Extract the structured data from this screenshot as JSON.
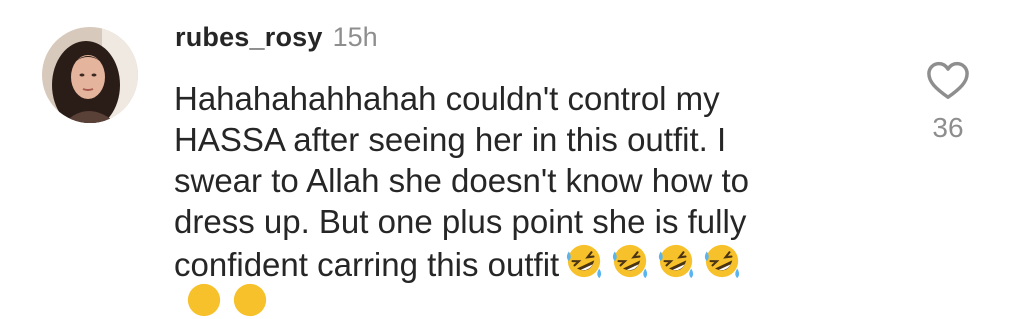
{
  "comment": {
    "username": "rubes_rosy",
    "timestamp": "15h",
    "text_lines": [
      "Hahahahahhahah couldn't control my",
      "HASSA after seeing her in this outfit. I",
      "swear to Allah she doesn't know how to",
      "dress up. But one plus point she is fully",
      "confident carring this outfit"
    ],
    "emoji": [
      "rolling-on-floor-laughing",
      "rolling-on-floor-laughing",
      "rolling-on-floor-laughing",
      "rolling-on-floor-laughing"
    ],
    "emoji_second_row_partial": [
      "rolling-on-floor-laughing",
      "rolling-on-floor-laughing"
    ],
    "likes": "36",
    "like_icon": "heart-outline-icon"
  },
  "colors": {
    "text": "#262626",
    "secondary": "#8e8e8e",
    "emoji_face": "#f7c12b"
  }
}
